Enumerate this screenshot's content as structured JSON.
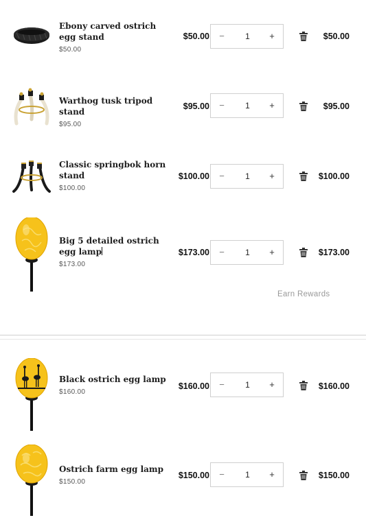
{
  "items": [
    {
      "title": "Ebony carved ostrich egg stand",
      "sub_price": "$50.00",
      "unit_price": "$50.00",
      "quantity": "1",
      "total": "$50.00",
      "image": "ebony-ring-stand"
    },
    {
      "title": "Warthog tusk tripod stand",
      "sub_price": "$95.00",
      "unit_price": "$95.00",
      "quantity": "1",
      "total": "$95.00",
      "image": "tusk-tripod"
    },
    {
      "title": "Classic springbok horn stand",
      "sub_price": "$100.00",
      "unit_price": "$100.00",
      "quantity": "1",
      "total": "$100.00",
      "image": "horn-stand"
    },
    {
      "title": "Big 5 detailed ostrich egg lamp",
      "sub_price": "$173.00",
      "unit_price": "$173.00",
      "quantity": "1",
      "total": "$173.00",
      "image": "egg-lamp"
    },
    {
      "title": "Black ostrich egg lamp",
      "sub_price": "$160.00",
      "unit_price": "$160.00",
      "quantity": "1",
      "total": "$160.00",
      "image": "egg-lamp-black"
    },
    {
      "title": "Ostrich farm egg lamp",
      "sub_price": "$150.00",
      "unit_price": "$150.00",
      "quantity": "1",
      "total": "$150.00",
      "image": "egg-lamp-farm"
    }
  ],
  "stepper": {
    "minus": "−",
    "plus": "+"
  },
  "rewards_label": "Earn Rewards",
  "colors": {
    "egg_yellow": "#f6c21b",
    "stand_black": "#1a1a1a",
    "border": "#cfcfcf"
  }
}
